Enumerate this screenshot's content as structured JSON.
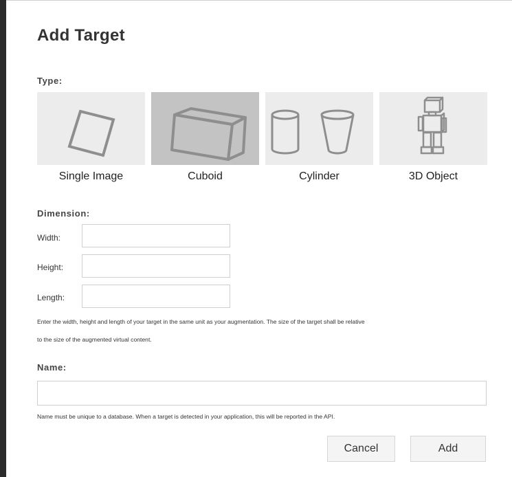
{
  "dialog": {
    "title": "Add Target"
  },
  "type_section": {
    "label": "Type:",
    "selected": "Cuboid",
    "options": [
      {
        "label": "Single Image",
        "icon": "single-image-icon"
      },
      {
        "label": "Cuboid",
        "icon": "cuboid-icon"
      },
      {
        "label": "Cylinder",
        "icon": "cylinder-icon"
      },
      {
        "label": "3D Object",
        "icon": "3d-object-icon"
      }
    ]
  },
  "dimension": {
    "label": "Dimension:",
    "width_label": "Width:",
    "height_label": "Height:",
    "length_label": "Length:",
    "width_value": "",
    "height_value": "",
    "length_value": "",
    "help_line1": "Enter the width, height and length of your target in the same unit as your augmentation. The size of the target shall be relative",
    "help_line2": "to the size of the augmented virtual content."
  },
  "name": {
    "label": "Name:",
    "value": "",
    "help": "Name must be unique to a database. When a target is detected in your application, this will be reported in the API."
  },
  "buttons": {
    "cancel": "Cancel",
    "add": "Add"
  },
  "colors": {
    "tile_bg": "#ececec",
    "tile_selected_bg": "#c3c3c3",
    "icon_stroke": "#8e8e8e"
  }
}
